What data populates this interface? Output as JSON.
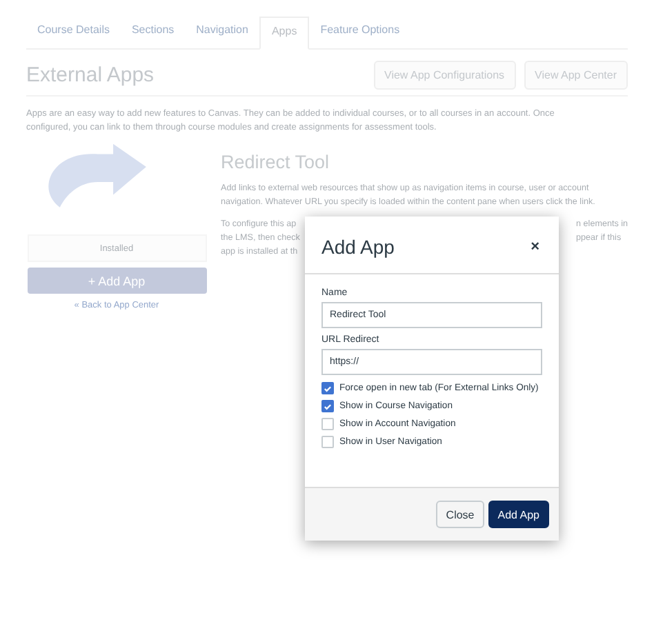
{
  "tabs": [
    {
      "label": "Course Details",
      "selected": false
    },
    {
      "label": "Sections",
      "selected": false
    },
    {
      "label": "Navigation",
      "selected": false
    },
    {
      "label": "Apps",
      "selected": true
    },
    {
      "label": "Feature Options",
      "selected": false
    }
  ],
  "header": {
    "title": "External Apps",
    "buttons": [
      "View App Configurations",
      "View App Center"
    ]
  },
  "intro": "Apps are an easy way to add new features to Canvas. They can be added to individual courses, or to all courses in an account. Once configured, you can link to them through course modules and create assignments for assessment tools.",
  "app": {
    "status": "Installed",
    "add_button": "+ Add App",
    "back_link": "« Back to App Center",
    "name": "Redirect Tool",
    "description": "Add links to external web resources that show up as navigation items in course, user or account navigation. Whatever URL you specify is loaded within the content pane when users click the link.",
    "config_left": [
      "To configure this ap",
      "the LMS, then check",
      "app is installed at th"
    ],
    "config_right": [
      "n elements in",
      "ppear if this"
    ]
  },
  "dialog": {
    "title": "Add App",
    "close_icon": "×",
    "fields": [
      {
        "label": "Name",
        "value": "Redirect Tool"
      },
      {
        "label": "URL Redirect",
        "value": "https://"
      }
    ],
    "options": [
      {
        "label": "Force open in new tab (For External Links Only)",
        "checked": true
      },
      {
        "label": "Show in Course Navigation",
        "checked": true
      },
      {
        "label": "Show in Account Navigation",
        "checked": false
      },
      {
        "label": "Show in User Navigation",
        "checked": false
      }
    ],
    "buttons": [
      {
        "label": "Close",
        "kind": "secondary"
      },
      {
        "label": "Add App",
        "kind": "primary"
      }
    ]
  }
}
